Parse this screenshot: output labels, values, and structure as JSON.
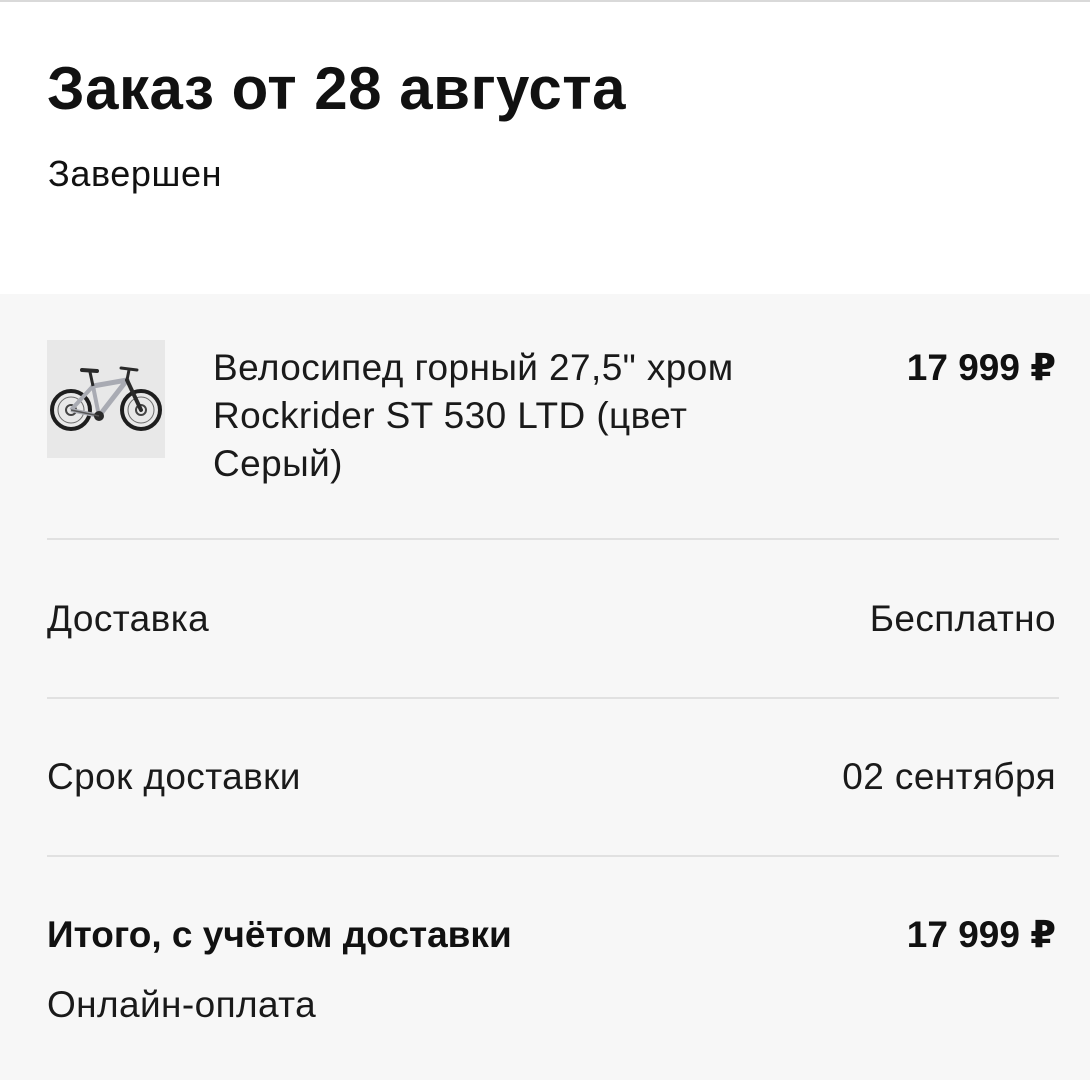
{
  "order": {
    "title": "Заказ от 28 августа",
    "status": "Завершен"
  },
  "item": {
    "name": "Велосипед горный 27,5\" хром Rockrider ST 530 LTD (цвет Серый)",
    "price": "17 999 ₽",
    "image_icon": "bicycle-icon"
  },
  "delivery": {
    "label": "Доставка",
    "value": "Бесплатно"
  },
  "delivery_date": {
    "label": "Срок доставки",
    "value": "02 сентября"
  },
  "total": {
    "label": "Итого, с учётом доставки",
    "value": "17 999 ₽",
    "payment_method": "Онлайн-оплата"
  },
  "colors": {
    "card_background": "#f7f7f7",
    "divider": "#e1e1e1",
    "text": "#111111"
  }
}
